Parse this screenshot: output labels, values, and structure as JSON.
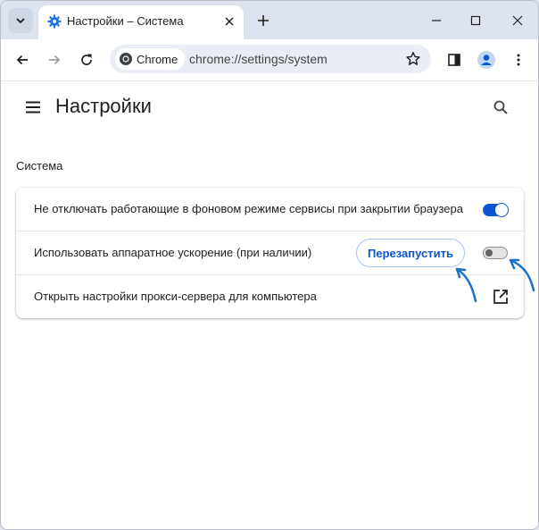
{
  "tab": {
    "title": "Настройки – Система",
    "icon": "gear-icon"
  },
  "toolbar": {
    "chip_label": "Chrome",
    "url": "chrome://settings/system"
  },
  "header": {
    "title": "Настройки"
  },
  "section": {
    "title": "Система"
  },
  "settings": {
    "rows": [
      {
        "label": "Не отключать работающие в фоновом режиме сервисы при закрытии браузера",
        "toggle_on": true
      },
      {
        "label": "Использовать аппаратное ускорение (при наличии)",
        "toggle_on": false,
        "button_label": "Перезапустить"
      },
      {
        "label": "Открыть настройки прокси-сервера для компьютера"
      }
    ]
  },
  "colors": {
    "accent": "#0b57d0",
    "toggle_off_track": "#e3e3e3",
    "toggle_off_knob": "#5f6368",
    "annotation_arrow": "#1a73c8",
    "tab_strip": "#dde3ee"
  }
}
